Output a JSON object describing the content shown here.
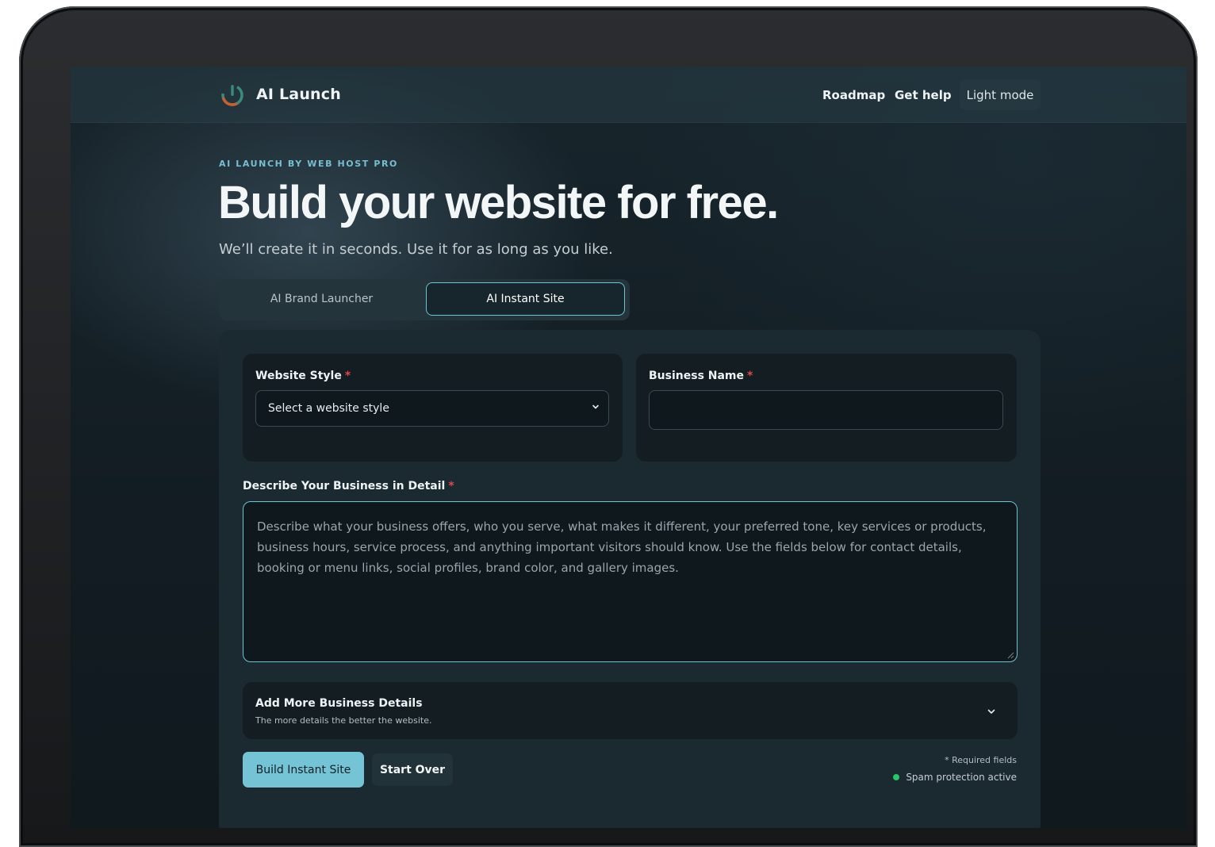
{
  "header": {
    "brand": "AI Launch",
    "nav": {
      "roadmap": "Roadmap",
      "help": "Get help"
    },
    "theme_toggle": "Light mode",
    "logo_icon": "power-ring-icon"
  },
  "hero": {
    "eyebrow": "AI LAUNCH BY WEB HOST PRO",
    "title": "Build your website for free.",
    "subtitle": "We’ll create it in seconds. Use it for as long as you like."
  },
  "tabs": [
    {
      "label": "AI Brand Launcher",
      "active": false
    },
    {
      "label": "AI Instant Site",
      "active": true
    }
  ],
  "form": {
    "website_style": {
      "label": "Website Style",
      "required_mark": "*",
      "selected": "Select a website style"
    },
    "business_name": {
      "label": "Business Name",
      "required_mark": "*",
      "value": ""
    },
    "description": {
      "label": "Describe Your Business in Detail",
      "required_mark": "*",
      "placeholder": "Describe what your business offers, who you serve, what makes it different, your preferred tone, key services or products, business hours, service process, and anything important visitors should know. Use the fields below for contact details, booking or menu links, social profiles, brand color, and gallery images."
    },
    "more_details": {
      "title": "Add More Business Details",
      "subtitle": "The more details the better the website."
    },
    "build_button": "Build Instant Site",
    "start_over_button": "Start Over",
    "required_note": "* Required fields",
    "spam_status": "Spam protection active"
  },
  "colors": {
    "accent": "#74c4d6",
    "required": "#e0484f",
    "status_ok": "#2bc46a",
    "background": "#131d22"
  }
}
